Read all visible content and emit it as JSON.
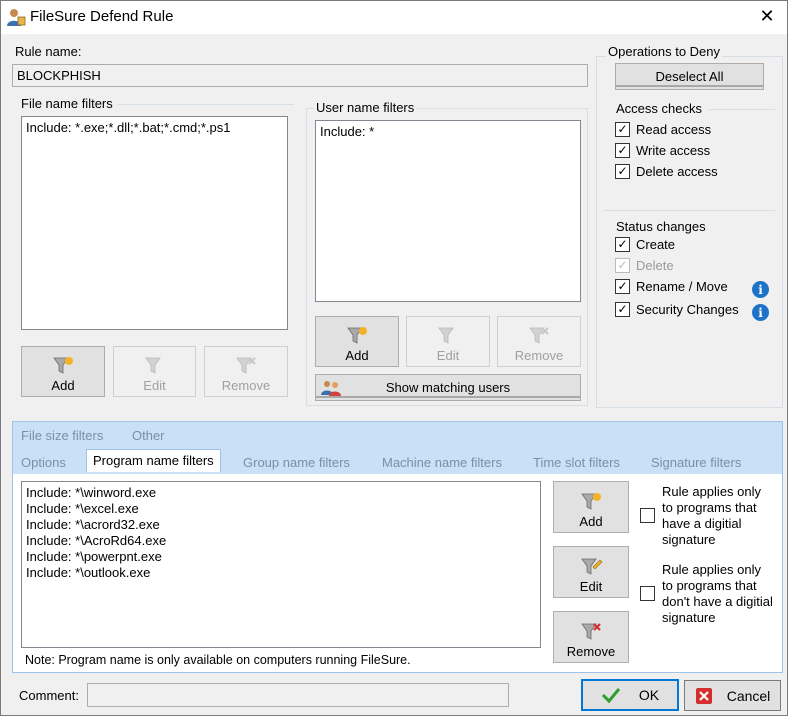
{
  "window": {
    "title": "FileSure Defend Rule",
    "close_glyph": "✕"
  },
  "rule_name": {
    "label": "Rule name:",
    "value": "BLOCKPHISH"
  },
  "file_name_filters": {
    "label": "File name filters",
    "items": [
      "Include: *.exe;*.dll;*.bat;*.cmd;*.ps1"
    ],
    "buttons": {
      "add": "Add",
      "edit": "Edit",
      "remove": "Remove"
    }
  },
  "user_name_filters": {
    "label": "User name filters",
    "items": [
      "Include: *"
    ],
    "buttons": {
      "add": "Add",
      "edit": "Edit",
      "remove": "Remove"
    },
    "show_matching_users": "Show matching users"
  },
  "operations": {
    "label": "Operations to Deny",
    "deselect_all": "Deselect All",
    "access_checks": {
      "label": "Access checks",
      "items": [
        {
          "label": "Read access",
          "checked": true
        },
        {
          "label": "Write access",
          "checked": true
        },
        {
          "label": "Delete access",
          "checked": true
        }
      ]
    },
    "status_changes": {
      "label": "Status changes",
      "items": [
        {
          "label": "Create",
          "checked": true,
          "disabled": false
        },
        {
          "label": "Delete",
          "checked": true,
          "disabled": true
        },
        {
          "label": "Rename / Move",
          "checked": true,
          "disabled": false,
          "info": true
        },
        {
          "label": "Security Changes",
          "checked": true,
          "disabled": false,
          "info": true
        }
      ]
    }
  },
  "tabs": {
    "row1": [
      "File size filters",
      "Other"
    ],
    "row2": [
      "Options",
      "Program name filters",
      "Group name filters",
      "Machine name filters",
      "Time slot filters",
      "Signature filters"
    ],
    "active": "Program name filters"
  },
  "program_filters": {
    "items": [
      "Include: *\\winword.exe",
      "Include: *\\excel.exe",
      "Include: *\\acrord32.exe",
      "Include: *\\AcroRd64.exe",
      "Include: *\\powerpnt.exe",
      "Include: *\\outlook.exe"
    ],
    "buttons": {
      "add": "Add",
      "edit": "Edit",
      "remove": "Remove"
    },
    "options": [
      {
        "label": "Rule applies only to programs that have a digitial signature",
        "checked": false
      },
      {
        "label": "Rule applies only to programs that don't have a digitial signature",
        "checked": false
      }
    ],
    "note": "Note: Program name is only available on computers running FileSure."
  },
  "comment": {
    "label": "Comment:",
    "value": ""
  },
  "footer": {
    "ok": "OK",
    "cancel": "Cancel"
  },
  "colors": {
    "tab_band": "#c9e0f7",
    "ok_border": "#0078d7",
    "info": "#1e73c8",
    "ok_check": "#2e9e2e",
    "cancel_x": "#d32f2f"
  }
}
